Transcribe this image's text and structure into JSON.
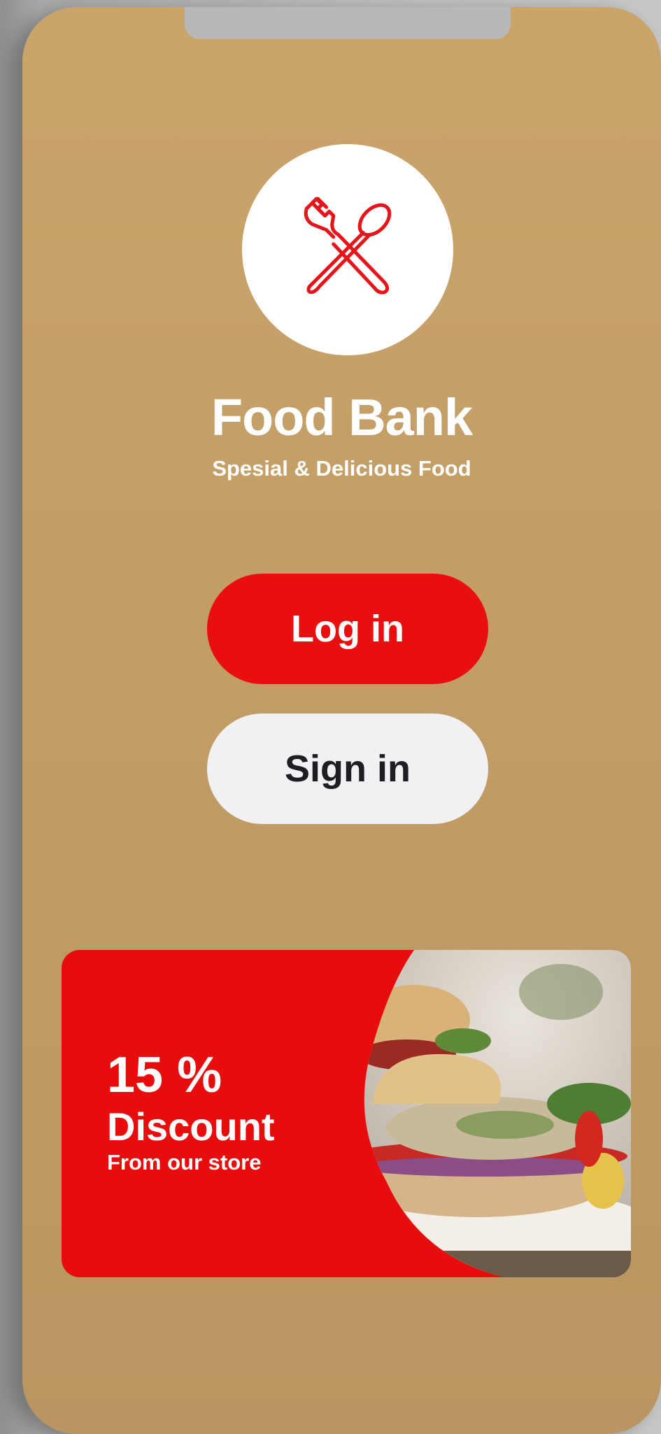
{
  "app": {
    "title": "Food Bank",
    "subtitle": "Spesial & Delicious Food"
  },
  "buttons": {
    "login_label": "Log in",
    "signin_label": "Sign in"
  },
  "promo": {
    "percent": "15 %",
    "headline": "Discount",
    "caption": "From our store"
  },
  "icons": {
    "logo": "fork-spoon-icon"
  },
  "colors": {
    "background": "#c29d66",
    "accent": "#ea0f0f",
    "secondary_button": "#f1f1f4",
    "text_light": "#ffffff",
    "text_dark": "#1d1d22"
  }
}
